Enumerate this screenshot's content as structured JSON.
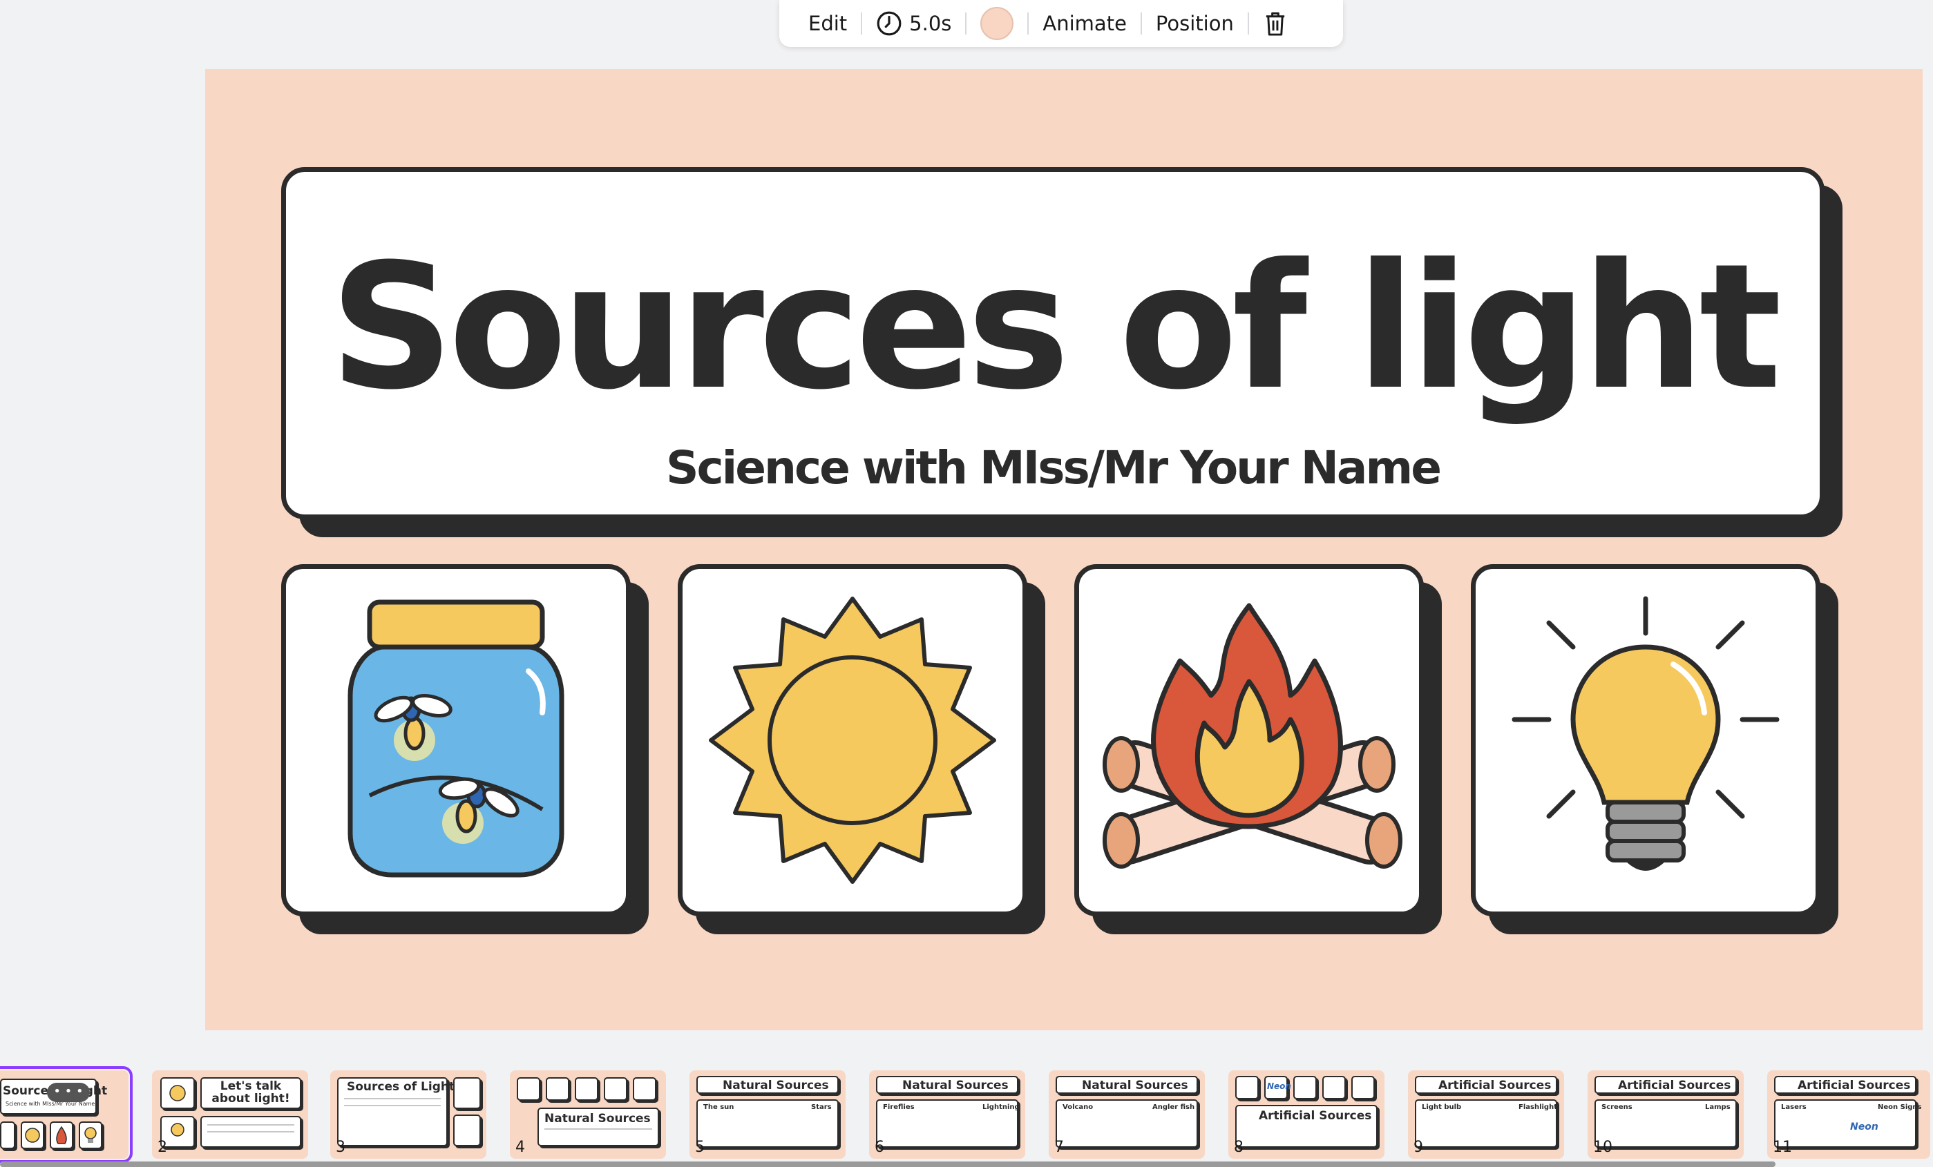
{
  "toolbar": {
    "edit_label": "Edit",
    "duration_label": "5.0s",
    "animate_label": "Animate",
    "position_label": "Position",
    "background_color": "#f8d6c3"
  },
  "slide": {
    "title": "Sources of light",
    "subtitle": "Science with MIss/Mr Your Name",
    "background": "#f8d7c4",
    "icons": [
      "firefly-jar-icon",
      "sun-icon",
      "campfire-icon",
      "light-bulb-icon"
    ]
  },
  "filmstrip": {
    "thumbs": [
      {
        "number": "",
        "title": "Sources of light",
        "subtitle": "Science with MIss/Mr Your Name"
      },
      {
        "number": "2",
        "title": "Let's talk about light!"
      },
      {
        "number": "3",
        "title": "Sources of Light"
      },
      {
        "number": "4",
        "title": "Natural Sources"
      },
      {
        "number": "5",
        "title": "Natural Sources",
        "labels": [
          "The sun",
          "Stars"
        ]
      },
      {
        "number": "6",
        "title": "Natural Sources",
        "labels": [
          "Fireflies",
          "Lightning"
        ]
      },
      {
        "number": "7",
        "title": "Natural Sources",
        "labels": [
          "Volcano",
          "Angler fish"
        ]
      },
      {
        "number": "8",
        "title": "Artificial Sources",
        "neon": "Neon"
      },
      {
        "number": "9",
        "title": "Artificial Sources",
        "labels": [
          "Light bulb",
          "Flashlight"
        ]
      },
      {
        "number": "10",
        "title": "Artificial Sources",
        "labels": [
          "Screens",
          "Lamps"
        ]
      },
      {
        "number": "11",
        "title": "Artificial Sources",
        "labels": [
          "Lasers",
          "Neon Signs"
        ],
        "neon": "Neon"
      }
    ]
  }
}
